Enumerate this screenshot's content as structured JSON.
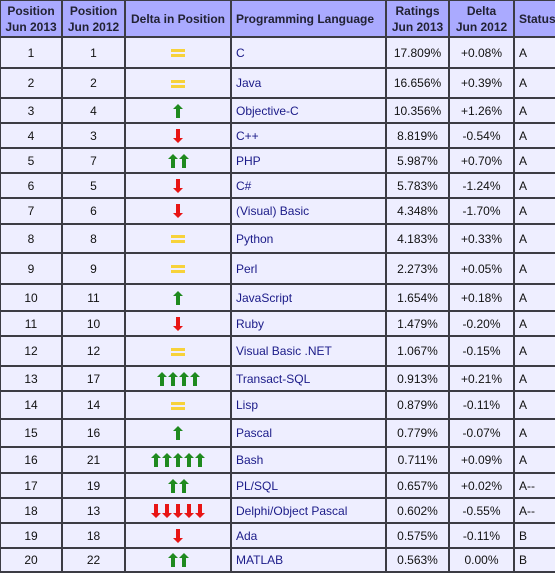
{
  "headers": {
    "position_2013": [
      "Position",
      "Jun 2013"
    ],
    "position_2012": [
      "Position",
      "Jun 2012"
    ],
    "delta_position": "Delta in Position",
    "language": "Programming Language",
    "ratings": [
      "Ratings",
      "Jun 2013"
    ],
    "delta": [
      "Delta",
      "Jun 2012"
    ],
    "status": "Status"
  },
  "colors": {
    "header_bg": "#aaaaff",
    "cell_bg": "#eeeeff",
    "border": "#3c3c44",
    "link": "#1a1a88",
    "up_arrow": "#1f8a1f",
    "down_arrow": "#e81515",
    "equal": "#f7d23a"
  },
  "rows": [
    {
      "pos2013": "1",
      "pos2012": "1",
      "trend": "equal",
      "count": 1,
      "language": "C",
      "rating": "17.809%",
      "delta": "+0.08%",
      "status": "A"
    },
    {
      "pos2013": "2",
      "pos2012": "2",
      "trend": "equal",
      "count": 1,
      "language": "Java",
      "rating": "16.656%",
      "delta": "+0.39%",
      "status": "A"
    },
    {
      "pos2013": "3",
      "pos2012": "4",
      "trend": "up",
      "count": 1,
      "language": "Objective-C",
      "rating": "10.356%",
      "delta": "+1.26%",
      "status": "A"
    },
    {
      "pos2013": "4",
      "pos2012": "3",
      "trend": "down",
      "count": 1,
      "language": "C++",
      "rating": "8.819%",
      "delta": "-0.54%",
      "status": "A"
    },
    {
      "pos2013": "5",
      "pos2012": "7",
      "trend": "up",
      "count": 2,
      "language": "PHP",
      "rating": "5.987%",
      "delta": "+0.70%",
      "status": "A"
    },
    {
      "pos2013": "6",
      "pos2012": "5",
      "trend": "down",
      "count": 1,
      "language": "C#",
      "rating": "5.783%",
      "delta": "-1.24%",
      "status": "A"
    },
    {
      "pos2013": "7",
      "pos2012": "6",
      "trend": "down",
      "count": 1,
      "language": "(Visual) Basic",
      "rating": "4.348%",
      "delta": "-1.70%",
      "status": "A"
    },
    {
      "pos2013": "8",
      "pos2012": "8",
      "trend": "equal",
      "count": 1,
      "language": "Python",
      "rating": "4.183%",
      "delta": "+0.33%",
      "status": "A"
    },
    {
      "pos2013": "9",
      "pos2012": "9",
      "trend": "equal",
      "count": 1,
      "language": "Perl",
      "rating": "2.273%",
      "delta": "+0.05%",
      "status": "A"
    },
    {
      "pos2013": "10",
      "pos2012": "11",
      "trend": "up",
      "count": 1,
      "language": "JavaScript",
      "rating": "1.654%",
      "delta": "+0.18%",
      "status": "A"
    },
    {
      "pos2013": "11",
      "pos2012": "10",
      "trend": "down",
      "count": 1,
      "language": "Ruby",
      "rating": "1.479%",
      "delta": "-0.20%",
      "status": "A"
    },
    {
      "pos2013": "12",
      "pos2012": "12",
      "trend": "equal",
      "count": 1,
      "language": "Visual Basic .NET",
      "rating": "1.067%",
      "delta": "-0.15%",
      "status": "A"
    },
    {
      "pos2013": "13",
      "pos2012": "17",
      "trend": "up",
      "count": 4,
      "language": "Transact-SQL",
      "rating": "0.913%",
      "delta": "+0.21%",
      "status": "A"
    },
    {
      "pos2013": "14",
      "pos2012": "14",
      "trend": "equal",
      "count": 1,
      "language": "Lisp",
      "rating": "0.879%",
      "delta": "-0.11%",
      "status": "A"
    },
    {
      "pos2013": "15",
      "pos2012": "16",
      "trend": "up",
      "count": 1,
      "language": "Pascal",
      "rating": "0.779%",
      "delta": "-0.07%",
      "status": "A"
    },
    {
      "pos2013": "16",
      "pos2012": "21",
      "trend": "up",
      "count": 5,
      "language": "Bash",
      "rating": "0.711%",
      "delta": "+0.09%",
      "status": "A"
    },
    {
      "pos2013": "17",
      "pos2012": "19",
      "trend": "up",
      "count": 2,
      "language": "PL/SQL",
      "rating": "0.657%",
      "delta": "+0.02%",
      "status": "A--"
    },
    {
      "pos2013": "18",
      "pos2012": "13",
      "trend": "down",
      "count": 5,
      "language": "Delphi/Object Pascal",
      "rating": "0.602%",
      "delta": "-0.55%",
      "status": "A--"
    },
    {
      "pos2013": "19",
      "pos2012": "18",
      "trend": "down",
      "count": 1,
      "language": "Ada",
      "rating": "0.575%",
      "delta": "-0.11%",
      "status": "B"
    },
    {
      "pos2013": "20",
      "pos2012": "22",
      "trend": "up",
      "count": 2,
      "language": "MATLAB",
      "rating": "0.563%",
      "delta": "0.00%",
      "status": "B"
    }
  ]
}
